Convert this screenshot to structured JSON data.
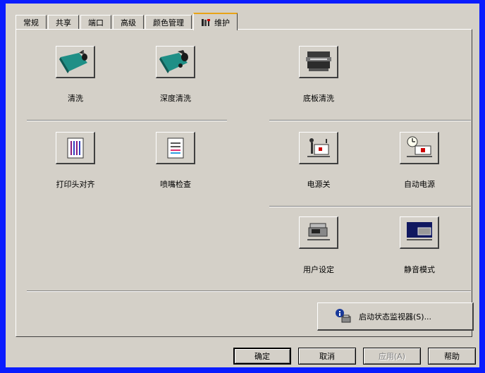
{
  "tabs": [
    {
      "label": "常规"
    },
    {
      "label": "共享"
    },
    {
      "label": "端口"
    },
    {
      "label": "高级"
    },
    {
      "label": "颜色管理"
    },
    {
      "label": "维护",
      "active": true
    }
  ],
  "maintenance": {
    "clean": "清洗",
    "deep_clean": "深度清洗",
    "bottom_plate_clean": "底板清洗",
    "head_align": "打印头对齐",
    "nozzle_check": "喷嘴检查",
    "power_off": "电源关",
    "auto_power": "自动电源",
    "custom_settings": "用户设定",
    "quiet_mode": "静音模式",
    "status_monitor": "启动状态监视器(S)..."
  },
  "buttons": {
    "ok": "确定",
    "cancel": "取消",
    "apply": "应用(A)",
    "help": "帮助"
  },
  "colors": {
    "frame": "#0a1cff",
    "face": "#d4d0c8",
    "teal": "#1f8f86"
  }
}
